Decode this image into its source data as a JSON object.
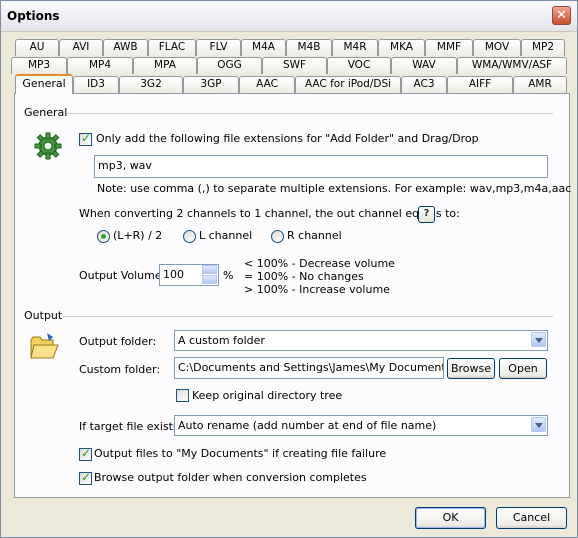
{
  "window": {
    "title": "Options"
  },
  "tabs": {
    "row1": [
      "AU",
      "AVI",
      "AWB",
      "FLAC",
      "FLV",
      "M4A",
      "M4B",
      "M4R",
      "MKA",
      "MMF",
      "MOV",
      "MP2"
    ],
    "row2": [
      "MP3",
      "MP4",
      "MPA",
      "OGG",
      "SWF",
      "VOC",
      "WAV",
      "WMA/WMV/ASF"
    ],
    "row3": [
      "General",
      "ID3",
      "3G2",
      "3GP",
      "AAC",
      "AAC for iPod/DSi",
      "AC3",
      "AIFF",
      "AMR"
    ],
    "active": "General"
  },
  "general": {
    "section_title": "General",
    "icon": "gear-icon",
    "only_add_checkbox": {
      "checked": true,
      "label": "Only add the following file extensions for \"Add Folder\" and Drag/Drop"
    },
    "extensions_value": "mp3, wav",
    "extensions_note": "Note: use comma (,) to separate multiple extensions. For example: wav,mp3,m4a,aac",
    "channels_label": "When converting 2 channels to 1 channel, the out channel equals to:",
    "help_button": "?",
    "channel_options": [
      {
        "label": "(L+R) / 2",
        "selected": true
      },
      {
        "label": "L channel",
        "selected": false
      },
      {
        "label": "R channel",
        "selected": false
      }
    ],
    "output_volume_label": "Output Volume:",
    "output_volume_value": "100",
    "percent_sign": "%",
    "volume_notes": [
      "< 100% - Decrease volume",
      "= 100% - No changes",
      "> 100% - Increase volume"
    ]
  },
  "output": {
    "section_title": "Output",
    "icon": "open-folder-icon",
    "output_folder_label": "Output folder:",
    "output_folder_value": "A custom folder",
    "custom_folder_label": "Custom folder:",
    "custom_folder_value": "C:\\Documents and Settings\\James\\My Documents",
    "browse_button": "Browse",
    "open_button": "Open",
    "keep_tree": {
      "checked": false,
      "label": "Keep original directory tree"
    },
    "if_exists_label": "If target file exists",
    "if_exists_value": "Auto rename (add number at end of file name)",
    "output_to_mydocs": {
      "checked": true,
      "label": "Output files to \"My Documents\" if creating file failure"
    },
    "browse_when_done": {
      "checked": true,
      "label": "Browse output folder when conversion completes"
    }
  },
  "footer": {
    "ok_button": "OK",
    "cancel_button": "Cancel"
  },
  "colors": {
    "tab_highlight": "#e68b2c",
    "check_green": "#21a121",
    "border_blue": "#7f9db9"
  }
}
